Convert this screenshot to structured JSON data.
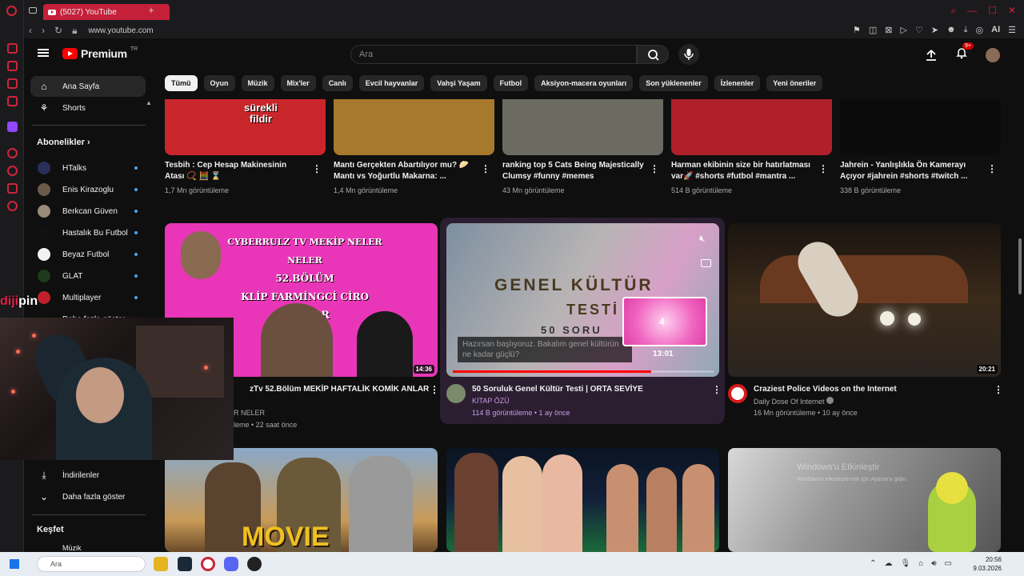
{
  "browser": {
    "tab_title": "(5027) YouTube",
    "url": "www.youtube.com",
    "ai_label": "AI"
  },
  "masthead": {
    "logo_word": "Premium",
    "logo_region": "TR",
    "search_placeholder": "Ara",
    "notif_badge": "9+"
  },
  "sidebar": {
    "main": [
      {
        "label": "Ana Sayfa",
        "icon": "home-icon",
        "active": true
      },
      {
        "label": "Shorts",
        "icon": "shorts-icon",
        "active": false
      }
    ],
    "subs_header": "Abonelikler",
    "subs": [
      {
        "label": "HTalks",
        "color": "#2a2f5a"
      },
      {
        "label": "Enis Kirazoglu",
        "color": "#6b5a4a"
      },
      {
        "label": "Berkcan Güven",
        "color": "#9a8a7a"
      },
      {
        "label": "Hastalık Bu Futbol",
        "color": "#111111"
      },
      {
        "label": "Beyaz Futbol",
        "color": "#f2f2f2"
      },
      {
        "label": "GLAT",
        "color": "#1d3a1d"
      },
      {
        "label": "Multiplayer",
        "color": "#c0202a"
      }
    ],
    "more_subs": "Daha fazla göster",
    "lower": [
      {
        "label": "İndirilenler",
        "icon": "download-icon"
      },
      {
        "label": "Daha fazla göster",
        "icon": "chevron-down-icon"
      }
    ],
    "explore_header": "Keşfet",
    "explore_first": "Müzik"
  },
  "chips": [
    "Tümü",
    "Oyun",
    "Müzik",
    "Mix'ler",
    "Canlı",
    "Evcil hayvanlar",
    "Vahşi Yaşam",
    "Futbol",
    "Aksiyon-macera oyunları",
    "Son yüklenenler",
    "İzlenenler",
    "Yeni öneriler"
  ],
  "row1": [
    {
      "title1": "Tesbih : Cep Hesap Makinesinin",
      "title2": "Atası 📿 🧮 ⌛",
      "meta": "1,7 Mn görüntüleme",
      "thumb_text": "sürekli\nfildir",
      "color": "#c8262a"
    },
    {
      "title1": "Mantı Gerçekten Abartılıyor mu? 🥟",
      "title2": "Mantı vs Yoğurtlu Makarna: ...",
      "meta": "1,4 Mn görüntüleme",
      "color": "#a7792c"
    },
    {
      "title1": "ranking top 5 Cats Being Majestically",
      "title2": "Clumsy #funny #memes",
      "meta": "43 Mn görüntüleme",
      "color": "#6b6b62"
    },
    {
      "title1": "Harman ekibinin size bir hatırlatması",
      "title2": "var🚀 #shorts #futbol #mantra ...",
      "meta": "514 B görüntüleme",
      "color": "#b02028"
    },
    {
      "title1": "Jahrein - Yanlışlıkla Ön Kamerayı",
      "title2": "Açıyor #jahrein #shorts #twitch ...",
      "meta": "338 B görüntüleme",
      "color": "#0b0b0b"
    }
  ],
  "row2": [
    {
      "title": "zTv 52.Bölüm MEKİP HAFTALİK KOMİK ANLAR",
      "channel": "R NELER",
      "meta": "leme • 22 saat önce",
      "duration": "14:36",
      "thumb_lines": [
        "CYBERRULZ TV MEKİP NELER NELER",
        "52.BÖLÜM",
        "KLİP FARMİNGCİ CİRO",
        "İZLİYOR"
      ]
    },
    {
      "title": "50 Soruluk Genel Kültür Testi | ORTA SEVİYE",
      "channel": "KİTAP ÖZÜ",
      "meta": "114 B görüntüleme • 1 ay önce",
      "thumb_line1": "GENEL KÜLTÜR",
      "thumb_line2": "TESTİ",
      "thumb_line3": "50 SORU",
      "caption": "Hazırsan başlıyoruz. Bakalım genel kültürün ne kadar güçlü?",
      "preview_time": "13:01",
      "preview_num": "4",
      "progress": 0.76
    },
    {
      "title": "Craziest Police Videos on the Internet",
      "channel": "Daily Dose Of Internet",
      "meta": "16 Mn görüntüleme • 10 ay önce",
      "duration": "20:21"
    }
  ],
  "row3": [
    {
      "thumb_text": "MOVIE"
    },
    {},
    {}
  ],
  "overlay": {
    "brand_prefix": "diji",
    "brand_suffix": "pin",
    "watermark1": "Windows'u Etkinleştir",
    "watermark2": "Windows'u etkinleştirmek için Ayarlar'a gidin."
  },
  "taskbar": {
    "search": "Ara",
    "time": "20:56",
    "date": "9.03.2026"
  }
}
